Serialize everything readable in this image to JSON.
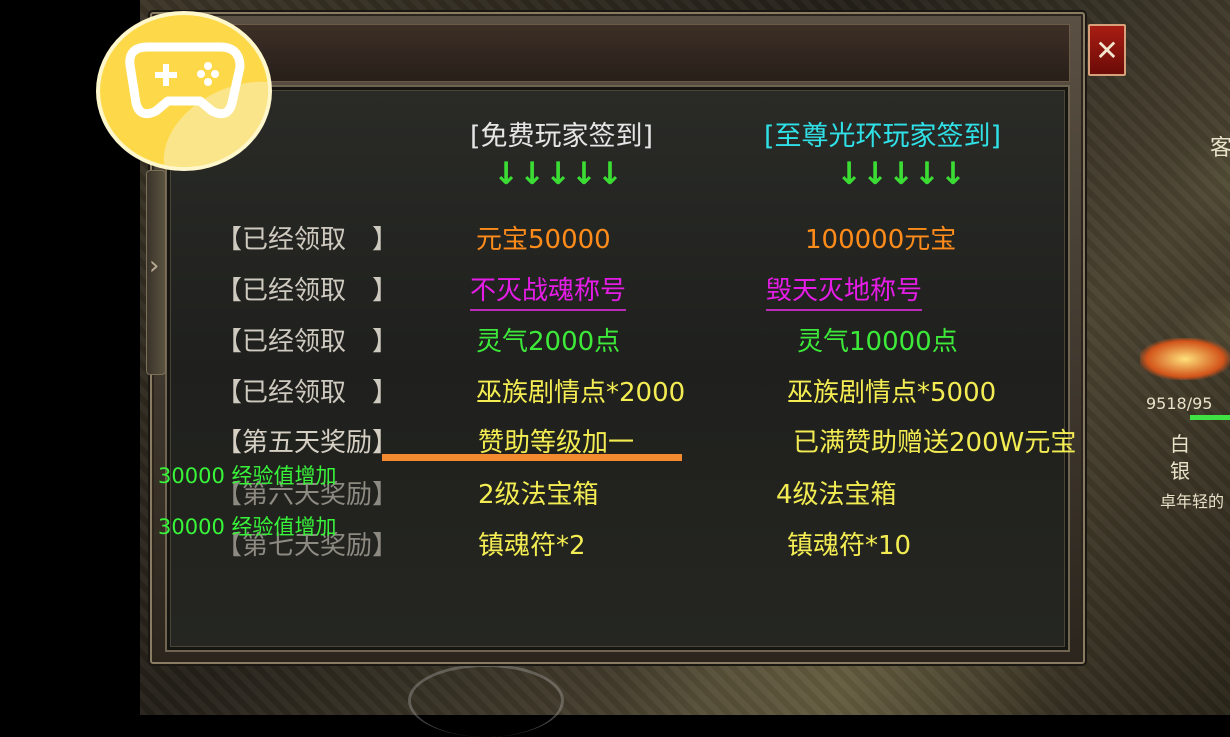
{
  "headers": {
    "free": "[免费玩家签到]",
    "premium": "[至尊光环玩家签到]",
    "free_arrows": "↓↓↓↓↓",
    "premium_arrows": "↓↓↓↓↓"
  },
  "rows": [
    {
      "label": "【已经领取　】",
      "free": "元宝50000",
      "premium": "100000元宝"
    },
    {
      "label": "【已经领取　】",
      "free": "不灭战魂称号",
      "premium": "毁天灭地称号"
    },
    {
      "label": "【已经领取　】",
      "free": "灵气2000点",
      "premium": "灵气10000点"
    },
    {
      "label": "【已经领取　】",
      "free": "巫族剧情点*2000",
      "premium": "巫族剧情点*5000"
    },
    {
      "label": "【第五天奖励】",
      "free": "赞助等级加一",
      "premium": "已满赞助赠送200W元宝"
    },
    {
      "label": "【第六天奖励】",
      "free": "2级法宝箱",
      "premium": "4级法宝箱"
    },
    {
      "label": "【第七天奖励】",
      "free": "镇魂符*2",
      "premium": "镇魂符*10"
    }
  ],
  "notifications": [
    "30000 经验值增加",
    "30000 经验值增加"
  ],
  "close_label": "✕",
  "side": {
    "hp_text": "9518/95",
    "char_a": "白",
    "char_b": "银",
    "player_name": "卓年轻的",
    "tag": "客"
  },
  "colors": {
    "free_header": "#e6e6e6",
    "premium_header": "#2fe1e6",
    "arrow": "#3bdc34",
    "orange_value": "#ff8c1a",
    "magenta_value": "#e51ce6",
    "green_value": "#3dea3a",
    "yellow_value": "#f3ec52",
    "notification": "#38f53a",
    "highlight_line": "#f48a2f"
  },
  "icons": {
    "logo": "gamepad-icon",
    "close": "close-icon",
    "side_tab": "chevron-right-icon"
  }
}
